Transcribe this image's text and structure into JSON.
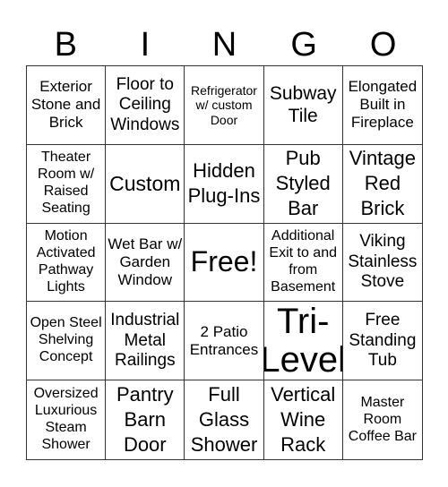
{
  "header": {
    "letters": [
      "B",
      "I",
      "N",
      "G",
      "O"
    ]
  },
  "cells": [
    "Exterior Stone and Brick",
    "Floor to Ceiling Windows",
    "Refrigerator w/ custom Door",
    "Subway Tile",
    "Elongated Built in Fireplace",
    "Theater Room w/ Raised Seating",
    "Custom",
    "Hidden Plug-Ins",
    "Pub Styled Bar",
    "Vintage Red Brick",
    "Motion Activated Pathway Lights",
    "Wet Bar w/ Garden Window",
    "Free!",
    "Additional Exit to and from Basement",
    "Viking Stainless Stove",
    "Open Steel Shelving Concept",
    "Industrial Metal Railings",
    "2 Patio Entrances",
    "Tri-Level",
    "Free Standing Tub",
    "Oversized Luxurious Steam Shower",
    "Pantry Barn Door",
    "Full Glass Shower",
    "Vertical Wine Rack",
    "Master Room Coffee Bar"
  ]
}
